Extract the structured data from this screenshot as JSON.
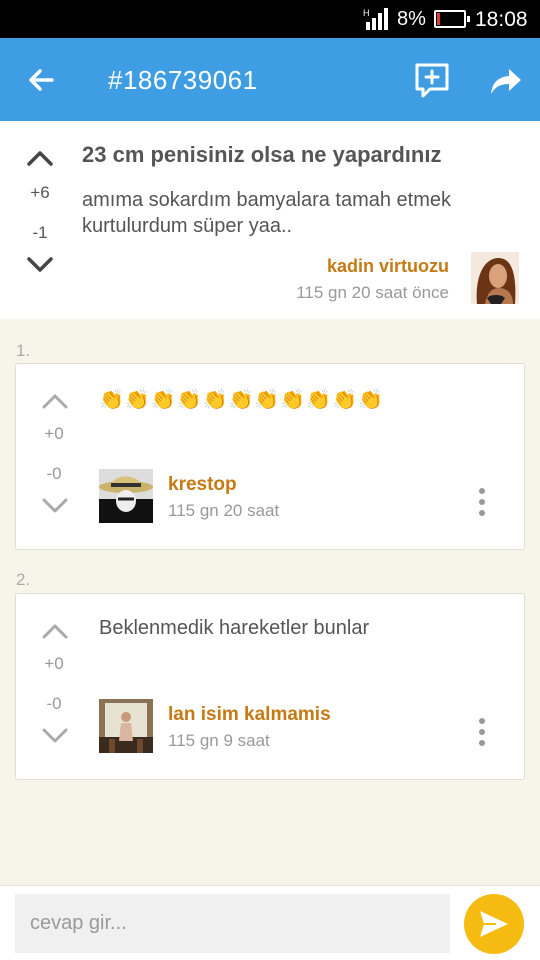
{
  "status_bar": {
    "battery_percent": "8%",
    "time": "18:08",
    "network_type": "H"
  },
  "app_bar": {
    "title": "#186739061",
    "icons": [
      "back-arrow-icon",
      "add-comment-icon",
      "share-icon"
    ]
  },
  "entry": {
    "title": "23 cm penisiniz olsa ne yapardınız",
    "body": "amıma sokardım bamyalara tamah etmek kurtulurdum süper yaa..",
    "upvotes": "+6",
    "downvotes": "-1",
    "author": "kadin virtuozu",
    "time": "115 gn 20 saat  önce"
  },
  "comments": [
    {
      "number": "1.",
      "text": "👏👏👏👏👏👏👏👏👏👏👏",
      "upvotes": "+0",
      "downvotes": "-0",
      "author": "krestop",
      "time": "115 gn 20 saat"
    },
    {
      "number": "2.",
      "text": "Beklenmedik hareketler bunlar",
      "upvotes": "+0",
      "downvotes": "-0",
      "author": "lan isim kalmamis",
      "time": "115 gn 9 saat"
    }
  ],
  "reply": {
    "placeholder": "cevap gir..."
  },
  "colors": {
    "app_bar": "#3e9de3",
    "author": "#c67a14",
    "send_button": "#f5bb10",
    "background": "#f7f4ea"
  }
}
